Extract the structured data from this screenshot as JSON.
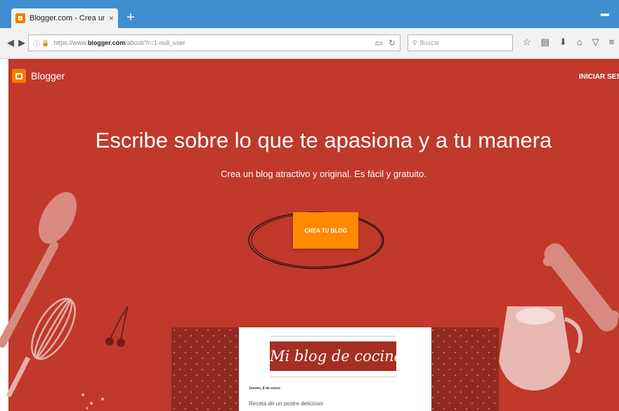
{
  "browser": {
    "tab_title": "Blogger.com - Crea un bl...",
    "tab_close": "×",
    "new_tab": "+",
    "url_prefix": "https://www.",
    "url_domain": "blogger.com",
    "url_path": "/about/?r=1-null_user",
    "search_placeholder": "Buscar",
    "icons": [
      "back-icon",
      "forward-icon",
      "info-icon",
      "lock-icon",
      "reader-view-icon",
      "reload-icon",
      "search-icon",
      "bookmark-star-icon",
      "reading-list-icon",
      "download-icon",
      "home-icon",
      "pocket-icon",
      "menu-icon"
    ]
  },
  "header": {
    "logo_text": "Blogger",
    "signin_label": "INICIAR SESI"
  },
  "hero": {
    "headline": "Escribe sobre lo que te apasiona y a tu manera",
    "subheadline": "Crea un blog atractivo y original. Es fácil y gratuito.",
    "cta_label": "CREA TU BLOG"
  },
  "preview": {
    "blog_title": "Mi blog de cocina",
    "date": "Jueves, 8 de enero",
    "post_title": "Receta de un postre delicioso"
  },
  "colors": {
    "hero_background": "#c0392b",
    "cta": "#ff8a00",
    "blogger_orange": "#f57d00",
    "browser_frame": "#3e8ed0"
  }
}
